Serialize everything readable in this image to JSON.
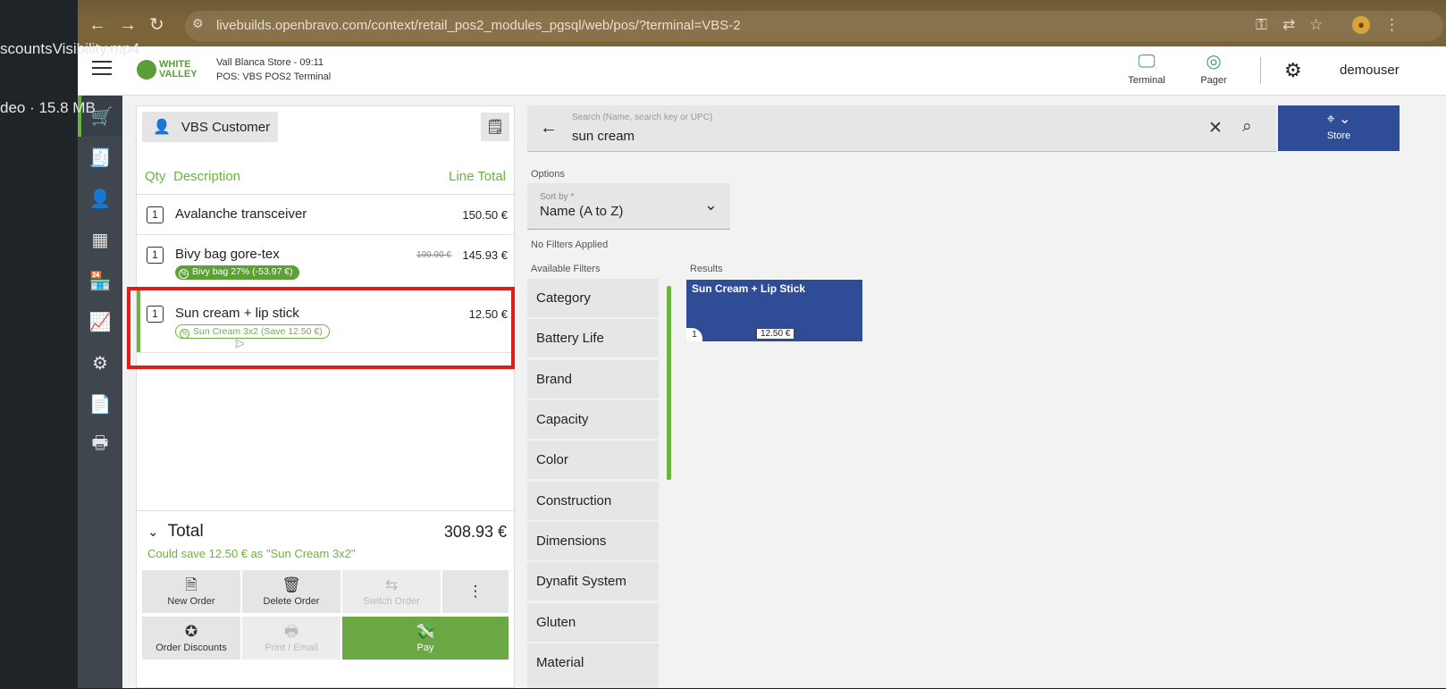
{
  "video": {
    "filename": "scountsVisibility.mp4",
    "meta": "deo · 15.8 MB"
  },
  "browser": {
    "url": "livebuilds.openbravo.com/context/retail_pos2_modules_pgsql/web/pos/?terminal=VBS-2"
  },
  "header": {
    "logo_line1": "WHITE",
    "logo_line2": "VALLEY",
    "store": "Vall Blanca Store - 09:11",
    "terminal_line": "POS: VBS POS2 Terminal",
    "terminal_btn": "Terminal",
    "pager_btn": "Pager",
    "user": "demouser"
  },
  "ticket": {
    "customer": "VBS Customer",
    "col_qty": "Qty",
    "col_desc": "Description",
    "col_total": "Line Total",
    "lines": [
      {
        "qty": "1",
        "desc": "Avalanche transceiver",
        "total": "150.50 €"
      },
      {
        "qty": "1",
        "desc": "Bivy bag gore-tex",
        "old_price": "199.90 €",
        "total": "145.93 €",
        "discount": "Bivy bag 27% (-53.97 €)"
      },
      {
        "qty": "1",
        "desc": "Sun cream + lip stick",
        "total": "12.50 €",
        "discount": "Sun Cream 3x2 (Save 12.50 €)"
      }
    ],
    "total_label": "Total",
    "total_amount": "308.93 €",
    "save_hint": "Could save 12.50 € as \"Sun Cream 3x2\"",
    "actions": {
      "new_order": "New Order",
      "delete_order": "Delete Order",
      "switch_order": "Switch Order",
      "order_discounts": "Order Discounts",
      "print_email": "Print / Email",
      "pay": "Pay"
    }
  },
  "search": {
    "placeholder": "Search (Name, search key or UPC)",
    "value": "sun cream",
    "store_btn": "Store",
    "options_label": "Options",
    "sort_label": "Sort by *",
    "sort_value": "Name (A to Z)",
    "no_filters": "No Filters Applied",
    "available_filters": "Available Filters",
    "results_label": "Results",
    "filters": [
      "Category",
      "Battery Life",
      "Brand",
      "Capacity",
      "Color",
      "Construction",
      "Dimensions",
      "Dynafit System",
      "Gluten",
      "Material"
    ]
  },
  "results": [
    {
      "name": "Sun Cream + Lip Stick",
      "qty": "1",
      "price": "12.50 €"
    }
  ],
  "colors": {
    "brand_green": "#6db33f",
    "accent_blue": "#2f4d97",
    "highlight_red": "#e01b1b"
  }
}
